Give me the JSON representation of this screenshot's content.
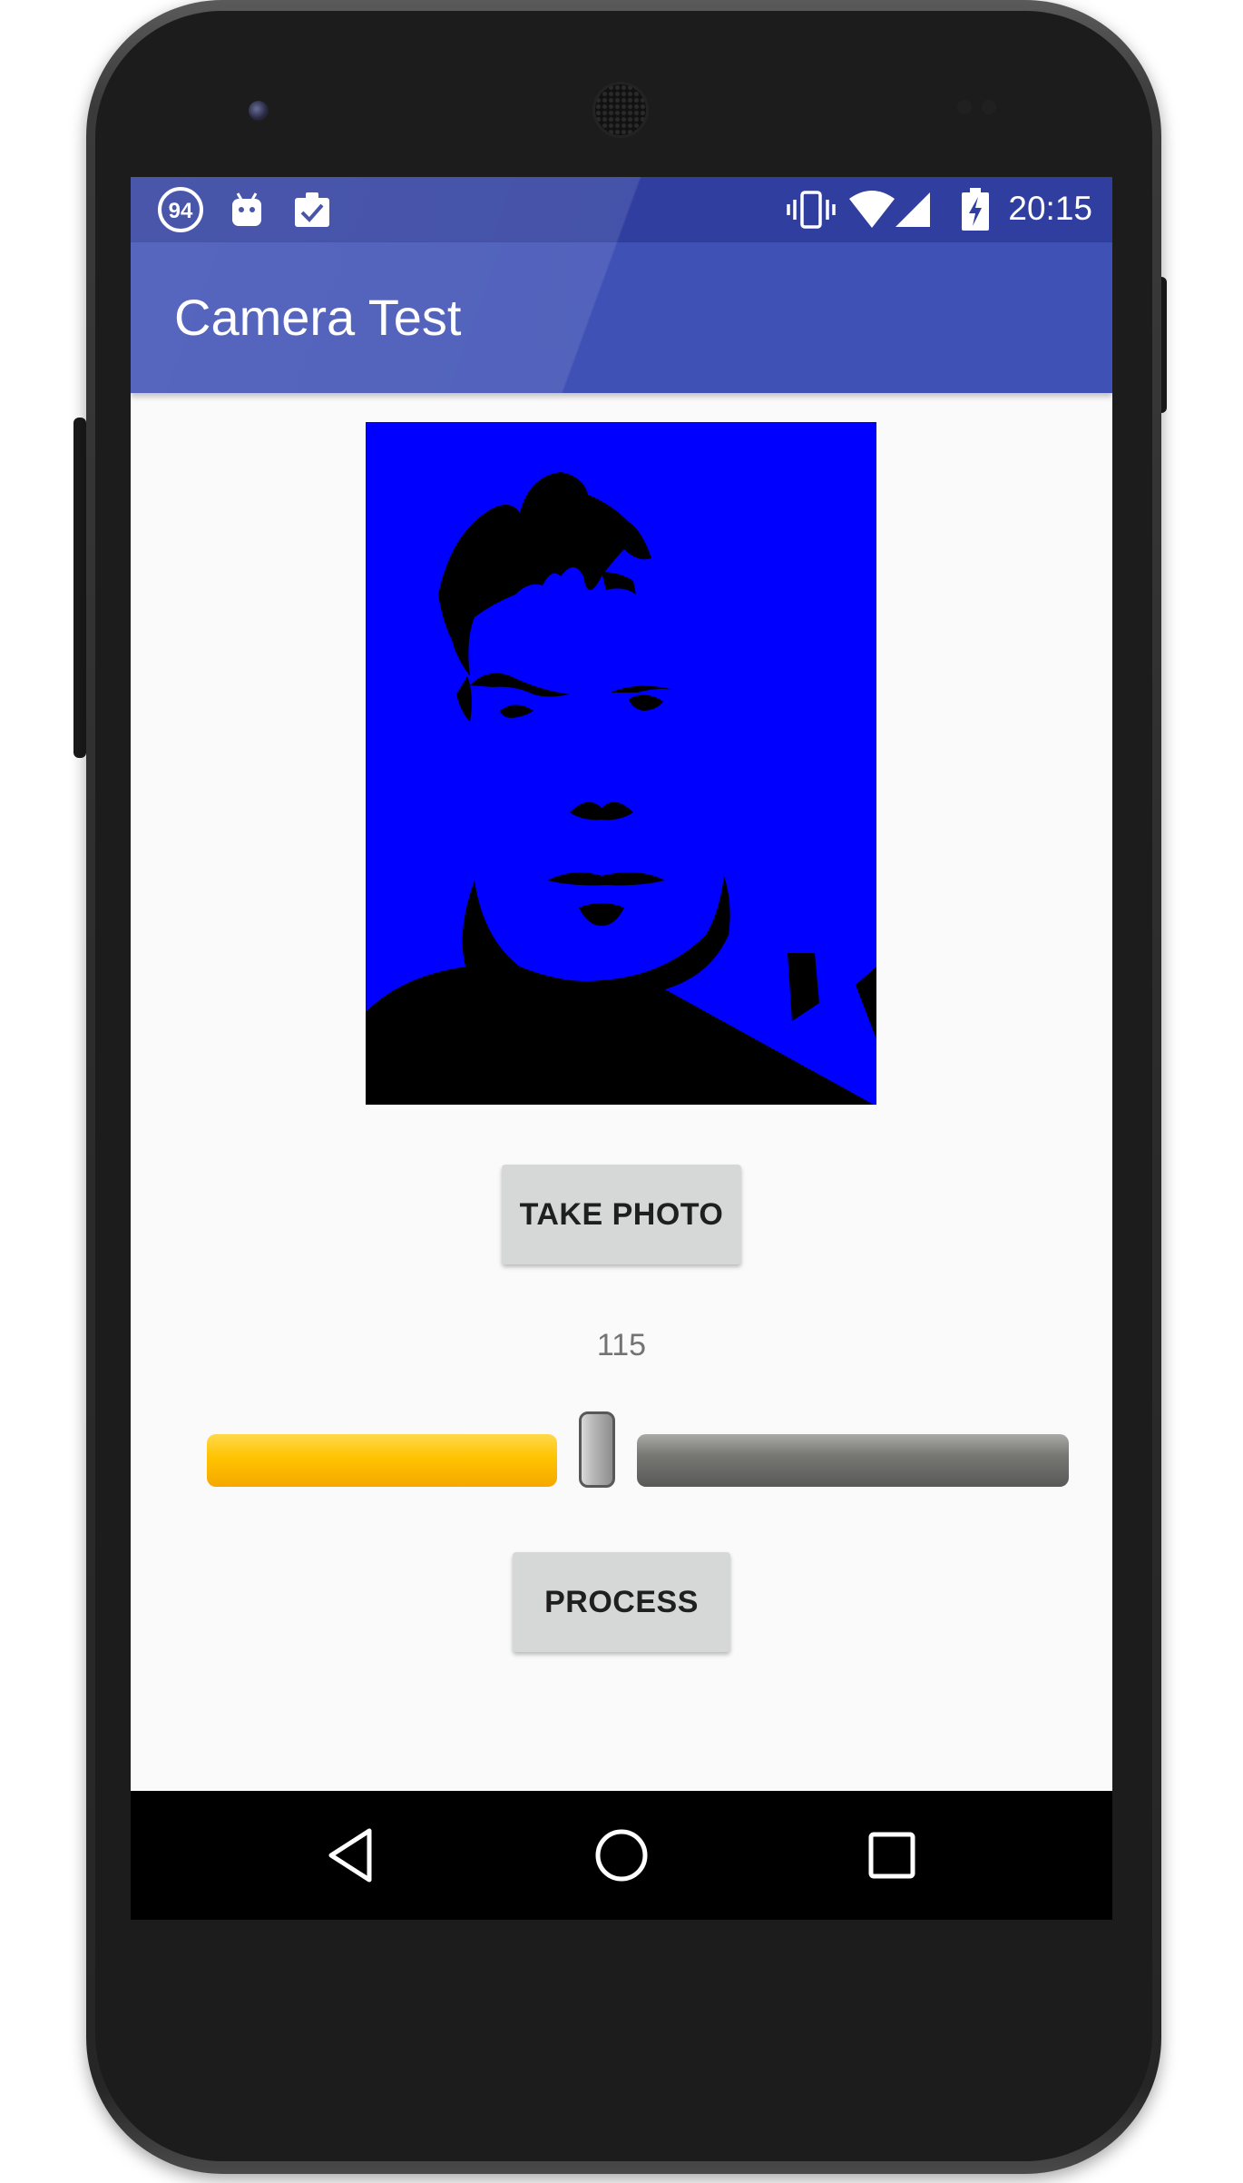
{
  "status_bar": {
    "notification_badge": "94",
    "time": "20:15",
    "icons": [
      "notification-94-icon",
      "android-icon",
      "clipboard-check-icon",
      "vibrate-icon",
      "wifi-icon",
      "signal-icon",
      "battery-charging-icon"
    ]
  },
  "app_bar": {
    "title": "Camera Test"
  },
  "main": {
    "photo_colors": {
      "background": "#0000ff",
      "foreground": "#000000"
    },
    "take_photo_label": "TAKE PHOTO",
    "threshold_value": "115",
    "slider": {
      "level": 0.45
    },
    "process_label": "PROCESS"
  },
  "nav_bar": {
    "icons": [
      "back-icon",
      "home-icon",
      "recents-icon"
    ]
  },
  "colors": {
    "primary": "#3f51b5",
    "primary_dark": "#303f9f",
    "accent": "#ffc107",
    "button": "#d6d7d7",
    "screen_background": "#fafafa"
  }
}
